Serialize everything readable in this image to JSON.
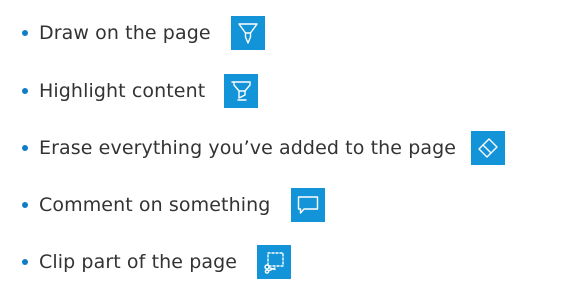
{
  "features": [
    {
      "label": "Draw on the page",
      "icon": "pen-icon"
    },
    {
      "label": "Highlight content",
      "icon": "highlighter-icon"
    },
    {
      "label": "Erase everything you’ve added to the page",
      "icon": "eraser-icon"
    },
    {
      "label": "Comment on something",
      "icon": "comment-icon"
    },
    {
      "label": "Clip part of the page",
      "icon": "clip-icon"
    }
  ],
  "colors": {
    "accent": "#1494d8",
    "bullet": "#0f7ec6",
    "text": "#333333",
    "background": "#ffffff"
  }
}
